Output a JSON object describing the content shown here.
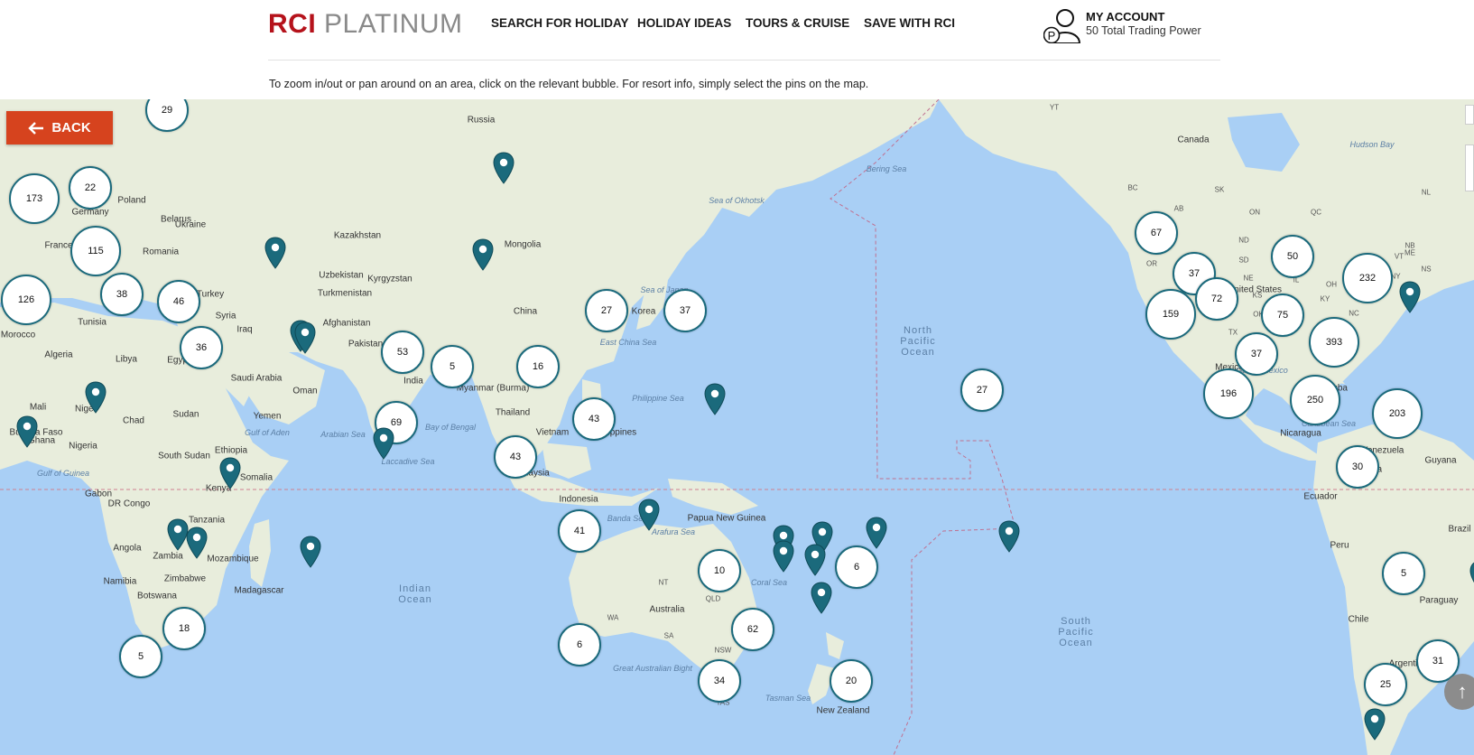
{
  "brand": {
    "logo_rci": "RCI",
    "logo_platinum": "PLATINUM"
  },
  "nav": [
    {
      "label": "SEARCH FOR HOLIDAY"
    },
    {
      "label": "HOLIDAY IDEAS"
    },
    {
      "label": "TOURS  & CRUISE"
    },
    {
      "label": "SAVE WITH RCI"
    }
  ],
  "account": {
    "title": "MY ACCOUNT",
    "points": "50 Total Trading Power",
    "badge": "P"
  },
  "instructions": "To zoom in/out or pan around on an area, click on the relevant bubble. For resort info, simply select the pins on the map.",
  "back_button": {
    "label": "BACK"
  },
  "map": {
    "country_labels": [
      "Russia",
      "Canada",
      "Belarus",
      "Poland",
      "Germany",
      "Ukraine",
      "France",
      "Romania",
      "Kazakhstan",
      "Mongolia",
      "Uzbekistan",
      "Kyrgyzstan",
      "Turkmenistan",
      "Turkey",
      "Syria",
      "Iraq",
      "Afghanistan",
      "Pakistan",
      "China",
      "Korea",
      "India",
      "Myanmar (Burma)",
      "Thailand",
      "Vietnam",
      "Philippines",
      "Malaysia",
      "Indonesia",
      "Papua New Guinea",
      "Australia",
      "New Zealand",
      "Morocco",
      "Algeria",
      "Libya",
      "Mali",
      "Niger",
      "Chad",
      "Sudan",
      "Nigeria",
      "South Sudan",
      "Ethiopia",
      "Somalia",
      "Kenya",
      "Tanzania",
      "DR Congo",
      "Gabon",
      "Angola",
      "Zambia",
      "Mozambique",
      "Zimbabwe",
      "Namibia",
      "Botswana",
      "Madagascar",
      "Saudi Arabia",
      "Yemen",
      "Oman",
      "Egypt",
      "Tunisia",
      "Ghana",
      "Burkina Faso",
      "United States",
      "Mexico",
      "Cuba",
      "Nicaragua",
      "Venezuela",
      "Guyana",
      "Colombia",
      "Ecuador",
      "Peru",
      "Brazil",
      "Chile",
      "Paraguay",
      "Argentina"
    ],
    "sea_labels": [
      "Bering Sea",
      "Sea of Okhotsk",
      "Sea of Japan",
      "East China Sea",
      "Philippine Sea",
      "Arabian Sea",
      "Bay of Bengal",
      "Laccadive Sea",
      "Gulf of Aden",
      "Gulf of Guinea",
      "Banda Sea",
      "Arafura Sea",
      "Coral Sea",
      "Tasman Sea",
      "Great Australian Bight",
      "Hudson Bay",
      "Gulf of Mexico",
      "Caribbean Sea"
    ],
    "ocean_labels": [
      "North Pacific Ocean",
      "South Pacific Ocean",
      "Indian Ocean"
    ],
    "region_labels": [
      "NT",
      "WA",
      "SA",
      "QLD",
      "NSW",
      "TAS",
      "YT",
      "BC",
      "AB",
      "SK",
      "ON",
      "QC",
      "NL",
      "NB",
      "NS",
      "ND",
      "SD",
      "NE",
      "KS",
      "OK",
      "TX",
      "LA",
      "IA",
      "IL",
      "OH",
      "KY",
      "NC",
      "ME",
      "VT",
      "NY",
      "OR",
      "CA"
    ],
    "clusters": [
      "29",
      "173",
      "22",
      "115",
      "126",
      "38",
      "46",
      "36",
      "53",
      "5",
      "16",
      "27",
      "37",
      "69",
      "43",
      "43",
      "41",
      "10",
      "6",
      "6",
      "62",
      "34",
      "20",
      "27",
      "67",
      "37",
      "50",
      "232",
      "159",
      "72",
      "75",
      "37",
      "393",
      "196",
      "250",
      "203",
      "30",
      "5",
      "31",
      "25",
      "18",
      "5"
    ],
    "pin_count": 24
  },
  "colors": {
    "water": "#a9cff5",
    "land": "#e8eddc",
    "pin": "#1b6a7c",
    "back": "#d6431e",
    "brand_red": "#b5121b"
  }
}
